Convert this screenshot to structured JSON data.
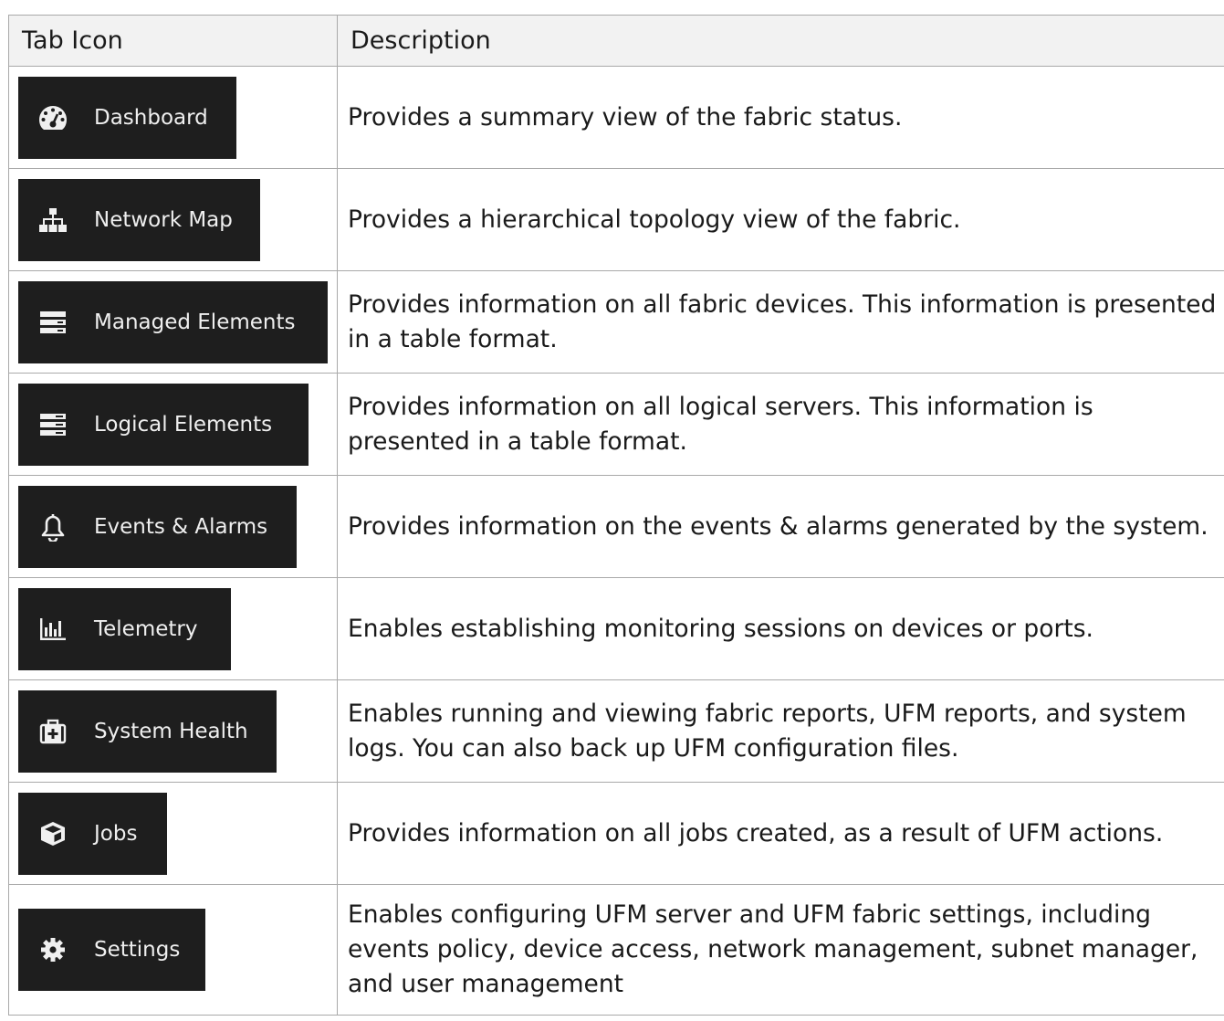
{
  "headers": {
    "tab_icon": "Tab Icon",
    "description": "Description"
  },
  "rows": [
    {
      "label": "Dashboard",
      "icon": "dashboard-icon",
      "description": "Provides a summary view of the fabric status."
    },
    {
      "label": "Network Map",
      "icon": "network-map-icon",
      "description": "Provides a hierarchical topology view of the fabric."
    },
    {
      "label": "Managed Elements",
      "icon": "managed-elements-icon",
      "description": "Provides information on all fabric devices. This information is presented in a table format."
    },
    {
      "label": "Logical Elements",
      "icon": "logical-elements-icon",
      "description": "Provides information on all logical servers. This information is presented in a table format."
    },
    {
      "label": "Events & Alarms",
      "icon": "bell-icon",
      "description": "Provides information on the events & alarms generated by the system."
    },
    {
      "label": "Telemetry",
      "icon": "bar-chart-icon",
      "description": "Enables establishing monitoring sessions on devices or ports."
    },
    {
      "label": "System Health",
      "icon": "medical-kit-icon",
      "description": "Enables running and viewing fabric reports, UFM reports, and system logs. You can also back up UFM configuration files."
    },
    {
      "label": "Jobs",
      "icon": "cube-icon",
      "description": "Provides information on all jobs created, as a result of UFM actions."
    },
    {
      "label": "Settings",
      "icon": "gear-icon",
      "description": "Enables configuring UFM server and UFM fabric settings, including events policy, device access, network management, subnet manager, and user management"
    }
  ]
}
